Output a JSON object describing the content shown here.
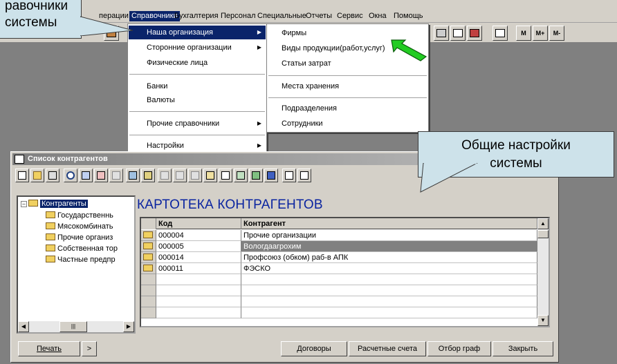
{
  "menubar": {
    "items": [
      "перации",
      "Справочники",
      "Бухгалтерия",
      "Персонал",
      "Специальные",
      "Отчеты",
      "Сервис",
      "Окна",
      "Помощь"
    ]
  },
  "toolbar": {
    "memory_buttons": [
      "M",
      "M+",
      "M-"
    ]
  },
  "menu_main": {
    "items": [
      "Наша организация",
      "Сторонние организации",
      "Физические лица",
      "Банки",
      "Валюты",
      "Прочие справочники",
      "Настройки"
    ]
  },
  "menu_sub": {
    "items": [
      "Фирмы",
      "Виды продукции(работ,услуг)",
      "Статьи затрат",
      "Места хранения",
      "Подразделения",
      "Сотрудники"
    ]
  },
  "callouts": {
    "top_left": "равочники\nсистемы",
    "right": "Общие настройки\nсистемы"
  },
  "window": {
    "title": "Список контрагентов",
    "tree": [
      "Контрагенты",
      "Государственнь",
      "Мясокомбинать",
      "Прочие организ",
      "Собственная тор",
      "Частные предпр"
    ],
    "card_title": "КАРТОТЕКА КОНТРАГЕНТОВ",
    "columns": [
      "Код",
      "Контрагент"
    ],
    "rows": [
      {
        "code": "000004",
        "name": "Прочие организации"
      },
      {
        "code": "000005",
        "name": "Вологдаагрохим"
      },
      {
        "code": "000014",
        "name": "Профсоюз (обком) раб-в АПК"
      },
      {
        "code": "000011",
        "name": "ФЭСКО"
      }
    ],
    "buttons": {
      "print": "Печать",
      "more": ">",
      "contracts": "Договоры",
      "accounts": "Расчетные счета",
      "select_cols": "Отбор граф",
      "close": "Закрыть"
    }
  },
  "colors": {
    "highlight": "#0a246a",
    "callout_bg": "#cde2ea",
    "arrow": "#22cc22",
    "card_title": "#0a24a0"
  }
}
